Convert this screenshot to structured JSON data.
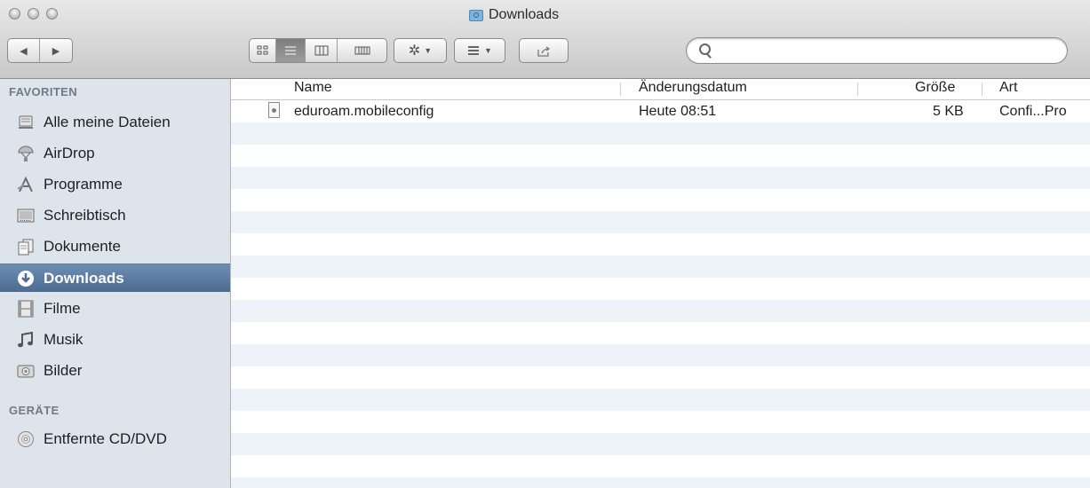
{
  "window": {
    "title": "Downloads",
    "controls": [
      "close",
      "minimize",
      "zoom"
    ]
  },
  "toolbar": {
    "back_icon": "◀",
    "forward_icon": "▶",
    "view_modes": [
      "icon-view",
      "list-view",
      "column-view",
      "coverflow-view"
    ],
    "active_view": "list-view",
    "action_icon": "gear-icon",
    "arrange_icon": "arrange-icon",
    "share_icon": "share-icon",
    "search_placeholder": "",
    "search_value": ""
  },
  "sidebar": {
    "favorites_label": "FAVORITEN",
    "devices_label": "GERÄTE",
    "favorites": [
      {
        "label": "Alle meine Dateien",
        "icon": "all-files-icon"
      },
      {
        "label": "AirDrop",
        "icon": "airdrop-icon"
      },
      {
        "label": "Programme",
        "icon": "applications-icon"
      },
      {
        "label": "Schreibtisch",
        "icon": "desktop-icon"
      },
      {
        "label": "Dokumente",
        "icon": "documents-icon"
      },
      {
        "label": "Downloads",
        "icon": "downloads-icon",
        "selected": true
      },
      {
        "label": "Filme",
        "icon": "movies-icon"
      },
      {
        "label": "Musik",
        "icon": "music-icon"
      },
      {
        "label": "Bilder",
        "icon": "pictures-icon"
      }
    ],
    "devices": [
      {
        "label": "Entfernte CD/DVD",
        "icon": "disc-icon"
      }
    ]
  },
  "columns": {
    "name": "Name",
    "date": "Änderungsdatum",
    "size": "Größe",
    "kind": "Art"
  },
  "files": [
    {
      "name": "eduroam.mobileconfig",
      "date": "Heute 08:51",
      "size": "5 KB",
      "kind": "Confi...Pro"
    }
  ],
  "colors": {
    "selection": "#5a7aa0",
    "sidebar_bg": "#dde4eb",
    "row_stripe": "#eef3f9"
  }
}
